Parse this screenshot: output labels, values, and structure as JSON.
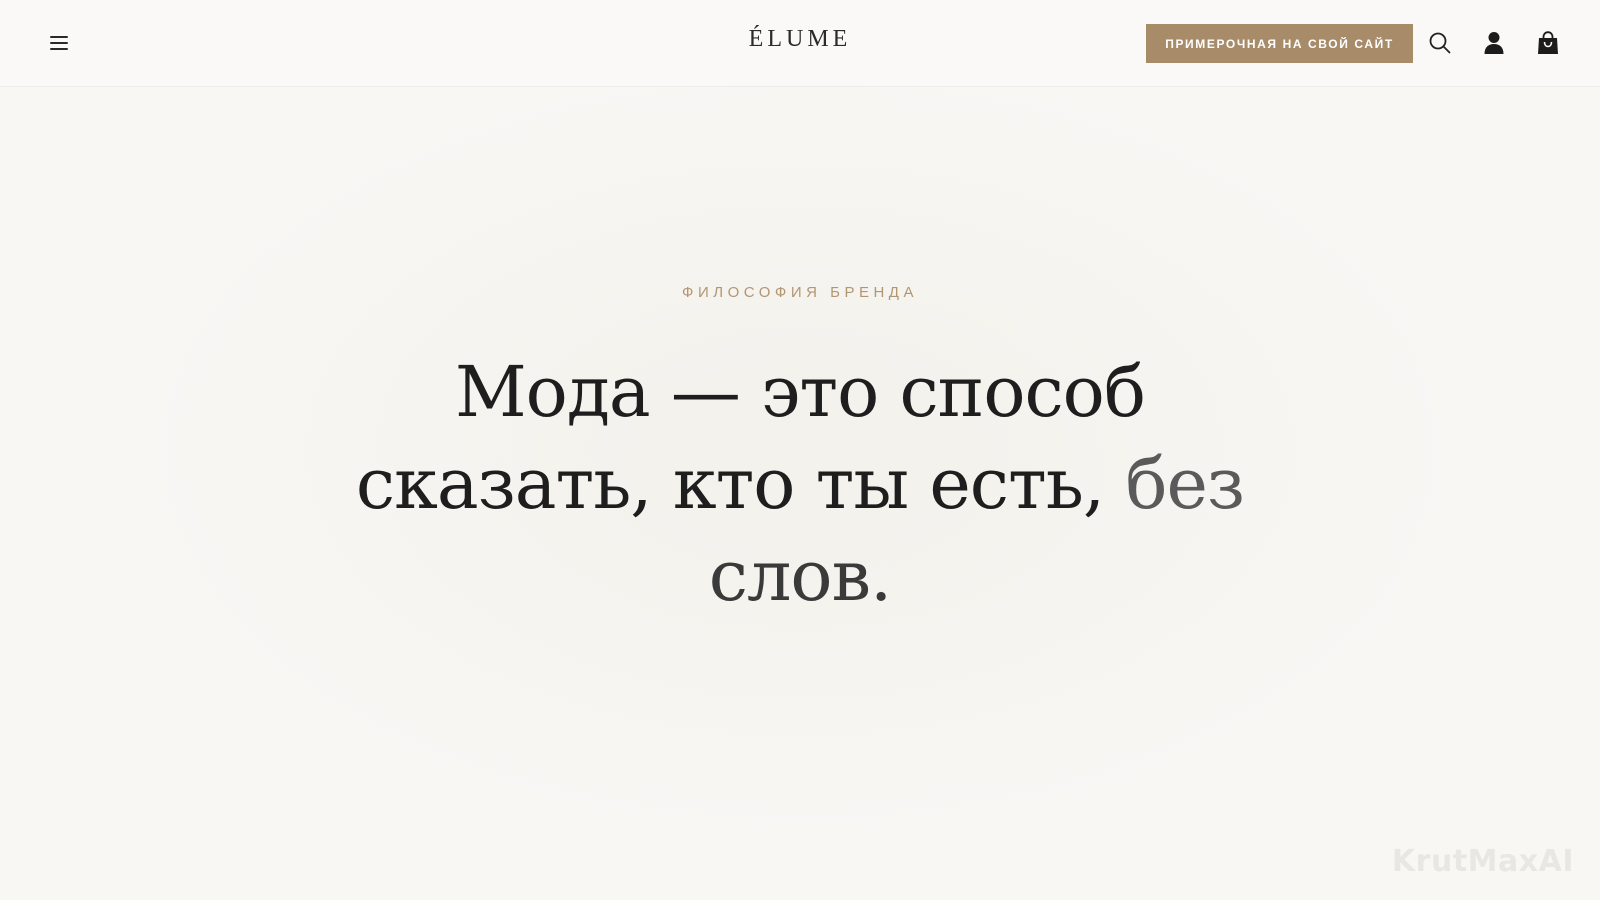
{
  "header": {
    "logo": "ÉLUME",
    "cta_label": "ПРИМЕРОЧНАЯ НА СВОЙ САЙТ",
    "icons": [
      "menu-icon",
      "search-icon",
      "user-icon",
      "shopping-bag-icon"
    ]
  },
  "hero": {
    "eyebrow": "ФИЛОСОФИЯ БРЕНДА",
    "headline_line1": "Мода — это способ",
    "headline_line2_main": "сказать, кто ты есть,",
    "headline_line2_end": "без",
    "headline_line3": "слов."
  },
  "watermark": "KrutMaxAI",
  "colors": {
    "background": "#f8f7f4",
    "accent": "#a88c6a",
    "eyebrow": "#b29672",
    "text": "#1e1e1e"
  }
}
